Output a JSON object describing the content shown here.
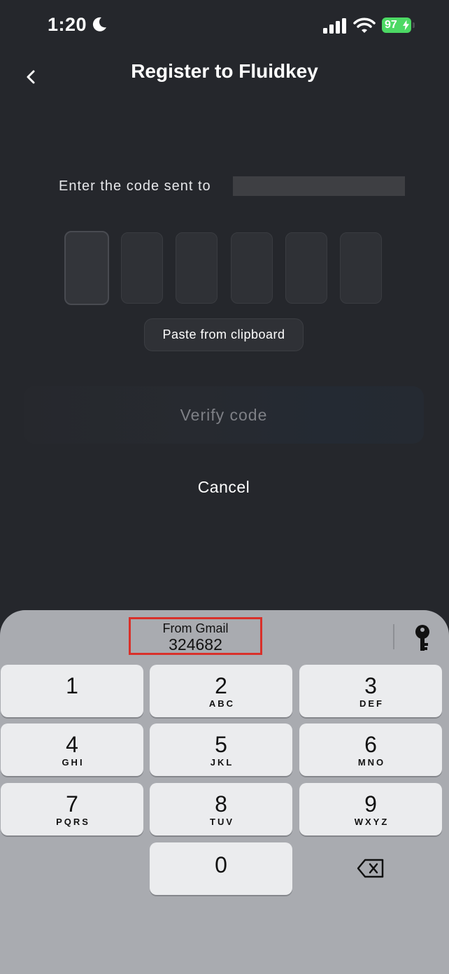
{
  "status_bar": {
    "time": "1:20",
    "battery": "97"
  },
  "header": {
    "title": "Register to Fluidkey"
  },
  "verification": {
    "prompt": "Enter the code sent to",
    "paste_label": "Paste from clipboard",
    "verify_label": "Verify code",
    "cancel_label": "Cancel"
  },
  "keyboard": {
    "suggestion": {
      "source": "From Gmail",
      "code": "324682"
    },
    "keys": [
      {
        "digit": "1",
        "letters": ""
      },
      {
        "digit": "2",
        "letters": "ABC"
      },
      {
        "digit": "3",
        "letters": "DEF"
      },
      {
        "digit": "4",
        "letters": "GHI"
      },
      {
        "digit": "5",
        "letters": "JKL"
      },
      {
        "digit": "6",
        "letters": "MNO"
      },
      {
        "digit": "7",
        "letters": "PQRS"
      },
      {
        "digit": "8",
        "letters": "TUV"
      },
      {
        "digit": "9",
        "letters": "WXYZ"
      },
      {
        "digit": "0",
        "letters": ""
      }
    ]
  },
  "colors": {
    "background": "#25272c",
    "battery": "#4cd964",
    "keyboard": "#a9abb0",
    "highlight_border": "#d9302a"
  },
  "icons": {
    "status": [
      "moon-icon",
      "cellular-signal-icon",
      "wifi-icon",
      "battery-icon"
    ],
    "header": [
      "chevron-left-icon"
    ],
    "keyboard": [
      "key-icon",
      "delete-backspace-icon"
    ]
  }
}
